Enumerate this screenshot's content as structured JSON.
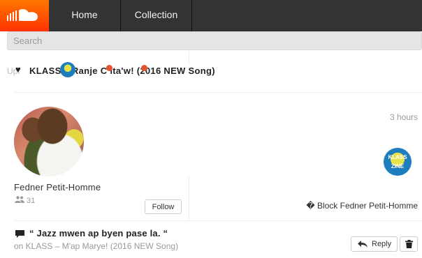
{
  "header": {
    "nav": {
      "home": "Home",
      "collection": "Collection"
    },
    "logo_icon": "soundcloud-cloud-icon"
  },
  "search": {
    "placeholder": "Search",
    "value": ""
  },
  "previous_item": {
    "ghost_label": "Upl",
    "heart_glyph": "♥",
    "title": "KLASS – Ranje C ita'w! (2016 NEW Song)"
  },
  "user_card": {
    "username": "Fedner Petit-Homme",
    "followers": "31",
    "follow_label": "Follow",
    "timestamp": "3 hours",
    "block_label": "� Block Fedner Petit-Homme",
    "artwork_text_1": "KLASS",
    "artwork_text_2": "ZINE"
  },
  "comment": {
    "text": "“ Jazz mwen ap byen pase la. “",
    "on_track": "on KLASS – M'ap Marye! (2016 NEW Song)",
    "reply_label": "Reply"
  },
  "colors": {
    "topbar": "#333333",
    "brand": "#ff5500",
    "accent_dot": "#e5532f"
  }
}
